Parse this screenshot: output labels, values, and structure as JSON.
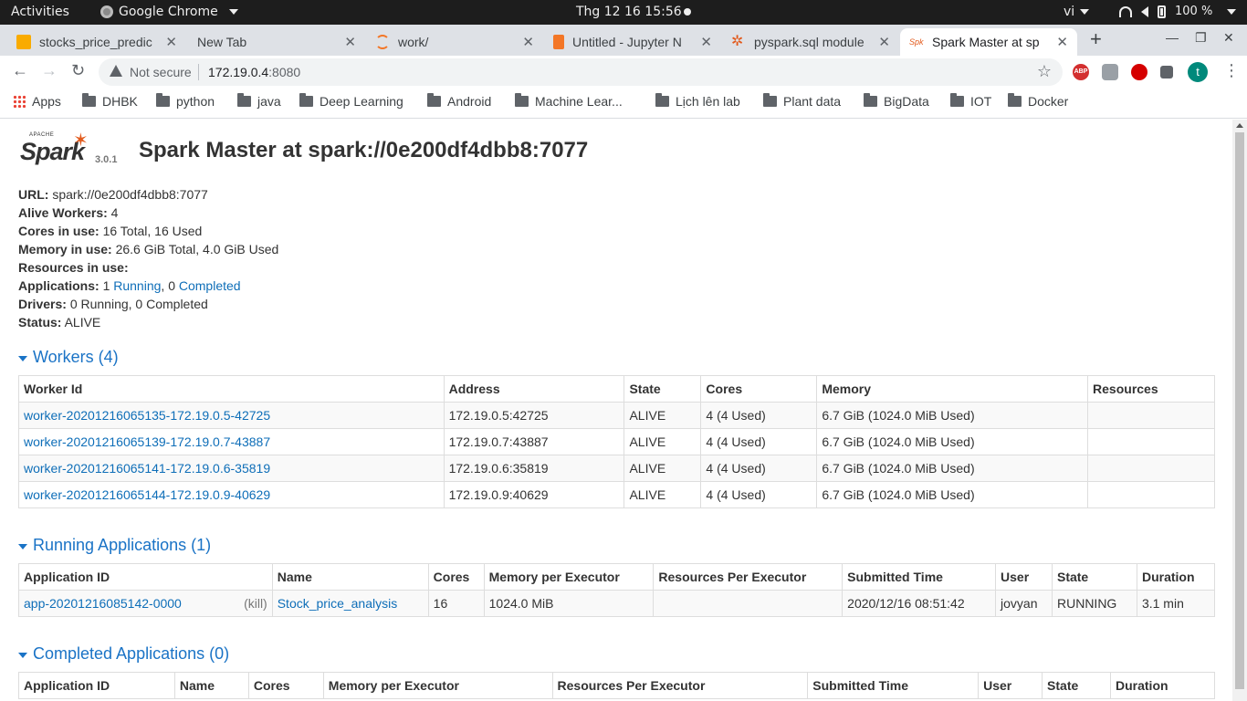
{
  "topbar": {
    "activities": "Activities",
    "app": "Google Chrome",
    "clock": "Thg 12 16  15:56",
    "lang": "vi",
    "battery": "100 %"
  },
  "tabs": [
    {
      "title": "stocks_price_predic",
      "icon": "jupyter-notebook-icon"
    },
    {
      "title": "New Tab",
      "icon": ""
    },
    {
      "title": "work/",
      "icon": "jupyter-icon"
    },
    {
      "title": "Untitled - Jupyter N",
      "icon": "notebook-icon"
    },
    {
      "title": "pyspark.sql module",
      "icon": "spark-icon"
    },
    {
      "title": "Spark Master at sp",
      "icon": "spark-icon"
    }
  ],
  "toolbar": {
    "not_secure": "Not secure",
    "url_host": "172.19.0.4",
    "url_port": ":8080",
    "avatar_letter": "t",
    "abp": "ABP"
  },
  "bookmarks": [
    "Apps",
    "DHBK",
    "python",
    "java",
    "Deep Learning",
    "Android",
    "Machine Lear...",
    "Lịch lên lab",
    "Plant data",
    "BigData",
    "IOT",
    "Docker"
  ],
  "page": {
    "logo_apache": "APACHE",
    "logo_spark": "Spark",
    "version": "3.0.1",
    "title": "Spark Master at spark://0e200df4dbb8:7077",
    "info": {
      "url_label": "URL:",
      "url": "spark://0e200df4dbb8:7077",
      "alive_label": "Alive Workers:",
      "alive": "4",
      "cores_label": "Cores in use:",
      "cores": "16 Total, 16 Used",
      "memory_label": "Memory in use:",
      "memory": "26.6 GiB Total, 4.0 GiB Used",
      "resources_label": "Resources in use:",
      "apps_label": "Applications:",
      "apps_running_count": "1",
      "apps_running": "Running",
      "apps_completed_count": "0",
      "apps_completed": "Completed",
      "drivers_label": "Drivers:",
      "drivers": "0 Running, 0 Completed",
      "status_label": "Status:",
      "status": "ALIVE"
    },
    "workers": {
      "heading": "Workers (4)",
      "columns": [
        "Worker Id",
        "Address",
        "State",
        "Cores",
        "Memory",
        "Resources"
      ],
      "rows": [
        [
          "worker-20201216065135-172.19.0.5-42725",
          "172.19.0.5:42725",
          "ALIVE",
          "4 (4 Used)",
          "6.7 GiB (1024.0 MiB Used)",
          ""
        ],
        [
          "worker-20201216065139-172.19.0.7-43887",
          "172.19.0.7:43887",
          "ALIVE",
          "4 (4 Used)",
          "6.7 GiB (1024.0 MiB Used)",
          ""
        ],
        [
          "worker-20201216065141-172.19.0.6-35819",
          "172.19.0.6:35819",
          "ALIVE",
          "4 (4 Used)",
          "6.7 GiB (1024.0 MiB Used)",
          ""
        ],
        [
          "worker-20201216065144-172.19.0.9-40629",
          "172.19.0.9:40629",
          "ALIVE",
          "4 (4 Used)",
          "6.7 GiB (1024.0 MiB Used)",
          ""
        ]
      ]
    },
    "running": {
      "heading": "Running Applications (1)",
      "columns": [
        "Application ID",
        "Name",
        "Cores",
        "Memory per Executor",
        "Resources Per Executor",
        "Submitted Time",
        "User",
        "State",
        "Duration"
      ],
      "rows": [
        {
          "id": "app-20201216085142-0000",
          "kill": "(kill)",
          "name": "Stock_price_analysis",
          "cores": "16",
          "mem": "1024.0 MiB",
          "res": "",
          "submitted": "2020/12/16 08:51:42",
          "user": "jovyan",
          "state": "RUNNING",
          "duration": "3.1 min"
        }
      ]
    },
    "completed": {
      "heading": "Completed Applications (0)",
      "columns": [
        "Application ID",
        "Name",
        "Cores",
        "Memory per Executor",
        "Resources Per Executor",
        "Submitted Time",
        "User",
        "State",
        "Duration"
      ]
    }
  },
  "colors": {
    "link": "#0e6eb8",
    "heading": "#1a73c6",
    "tabstrip": "#dee1e6",
    "topbar": "#1d1d1d"
  }
}
